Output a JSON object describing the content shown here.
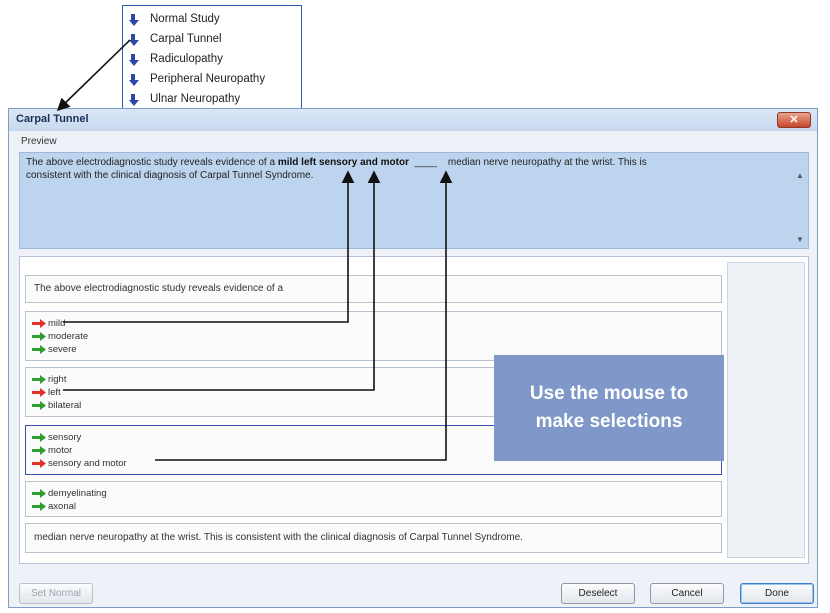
{
  "template_menu": {
    "items": [
      "Normal Study",
      "Carpal Tunnel",
      "Radiculopathy",
      "Peripheral Neuropathy",
      "Ulnar Neuropathy"
    ],
    "icon": "down-right-arrow-icon"
  },
  "dialog": {
    "title": "Carpal Tunnel",
    "close_icon": "close-icon",
    "preview_label": "Preview",
    "preview": {
      "lead": "The above electrodiagnostic study reveals evidence of a ",
      "selection": "mild left sensory and motor",
      "blank": "____",
      "trail_line1": "median nerve neuropathy at the wrist.  This is",
      "line2": "consistent with the clinical diagnosis of Carpal Tunnel Syndrome."
    },
    "blocks": {
      "intro": "The above electrodiagnostic study reveals evidence of a",
      "severity": [
        "mild",
        "moderate",
        "severe"
      ],
      "side": [
        "right",
        "left",
        "bilateral"
      ],
      "fiber": [
        "sensory",
        "motor",
        "sensory and motor"
      ],
      "type": [
        "demyelinating",
        "axonal"
      ],
      "closing": "median nerve neuropathy at the wrist.  This is consistent with the clinical diagnosis of Carpal Tunnel Syndrome."
    },
    "buttons": {
      "set_normal": "Set Normal",
      "deselect": "Deselect",
      "cancel": "Cancel",
      "done": "Done"
    }
  },
  "callout": {
    "line1": "Use the mouse to",
    "line2": "make selections"
  },
  "colors": {
    "selected_arrow": "#e8302a",
    "unselected_arrow": "#2f9e33",
    "callout_bg": "#7f97c9",
    "preview_bg": "#bdd4ee"
  }
}
